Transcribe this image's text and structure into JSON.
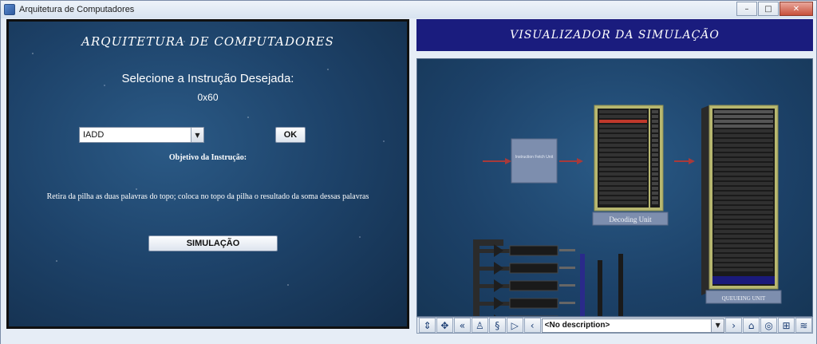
{
  "window": {
    "title": "Arquitetura de Computadores",
    "minimize": "–",
    "maximize": "□",
    "close": "✕"
  },
  "left": {
    "title": "ARQUITETURA DE COMPUTADORES",
    "select_label": "Selecione a Instrução Desejada:",
    "opcode": "0x60",
    "instruction_value": "IADD",
    "ok_label": "OK",
    "objective_label": "Objetivo da Instrução:",
    "objective_text": "Retira da pilha as duas palavras do topo; coloca no topo da pilha o resultado da soma dessas palavras",
    "simulate_label": "SIMULAÇÃO"
  },
  "right": {
    "header": "VISUALIZADOR DA SIMULAÇÃO",
    "fetch_label": "Instruction Fetch Unit",
    "decoding_label": "Decoding Unit",
    "queueing_label": "QUEUEING UNIT",
    "toolbar": {
      "view_description": "<No description>",
      "icons": [
        "rotate-icon",
        "pan-icon",
        "turn-left-icon",
        "walk-icon",
        "fly-icon",
        "play-icon",
        "previous-icon",
        "next-icon",
        "home-icon",
        "examine-icon",
        "fit-icon",
        "settings-icon"
      ]
    }
  },
  "colors": {
    "header_bg": "#1a1c7e",
    "panel_bg": "#1d4269",
    "rack_frame": "#b8b870",
    "rack_slot": "#2a2a2a",
    "highlight": "#c0392b"
  }
}
